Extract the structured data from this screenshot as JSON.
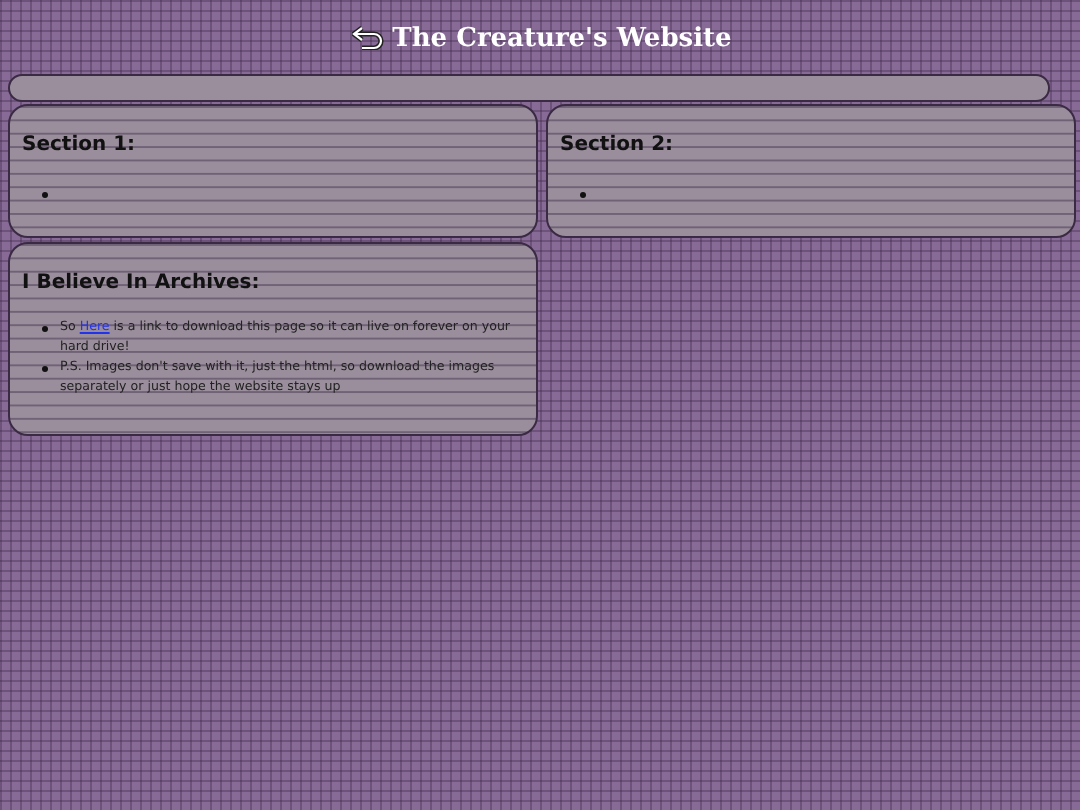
{
  "header": {
    "title": "The Creature's Website"
  },
  "sections": [
    {
      "heading": "Section 1:",
      "items": [
        {
          "kind": "empty"
        }
      ]
    },
    {
      "heading": "Section 2:",
      "items": [
        {
          "kind": "empty"
        }
      ]
    },
    {
      "heading": "I Believe In Archives:",
      "items": [
        {
          "kind": "text",
          "parts": [
            {
              "kind": "text",
              "text": "So "
            },
            {
              "kind": "link",
              "text": "Here"
            },
            {
              "kind": "text",
              "text": " is a link to download this page so it can live on forever on your hard drive!"
            }
          ]
        },
        {
          "kind": "text",
          "parts": [
            {
              "kind": "text",
              "text": "P.S. Images don't save with it, just the html, so download the images separately or just hope the website stays up"
            }
          ]
        }
      ]
    }
  ]
}
